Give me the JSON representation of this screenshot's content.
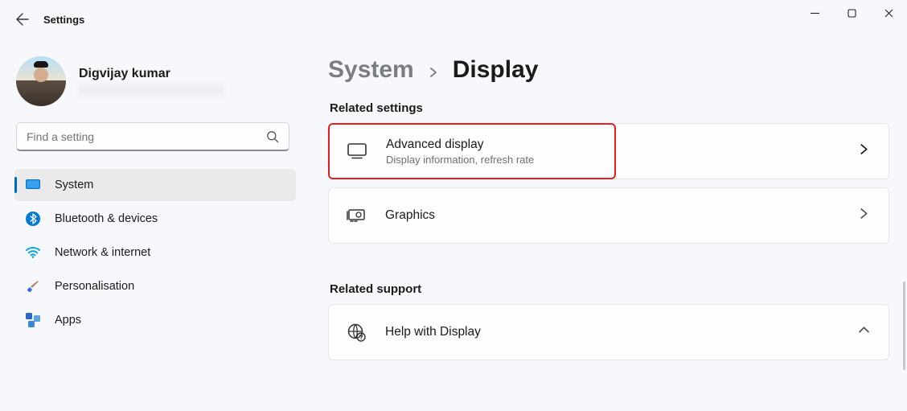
{
  "app_title": "Settings",
  "profile": {
    "name": "Digvijay kumar"
  },
  "search": {
    "placeholder": "Find a setting"
  },
  "sidebar": {
    "items": [
      {
        "label": "System"
      },
      {
        "label": "Bluetooth & devices"
      },
      {
        "label": "Network & internet"
      },
      {
        "label": "Personalisation"
      },
      {
        "label": "Apps"
      }
    ]
  },
  "breadcrumb": {
    "parent": "System",
    "current": "Display"
  },
  "sections": {
    "related_settings_label": "Related settings",
    "related_support_label": "Related support"
  },
  "cards": {
    "advanced": {
      "title": "Advanced display",
      "sub": "Display information, refresh rate"
    },
    "graphics": {
      "title": "Graphics"
    },
    "help": {
      "title": "Help with Display"
    }
  }
}
